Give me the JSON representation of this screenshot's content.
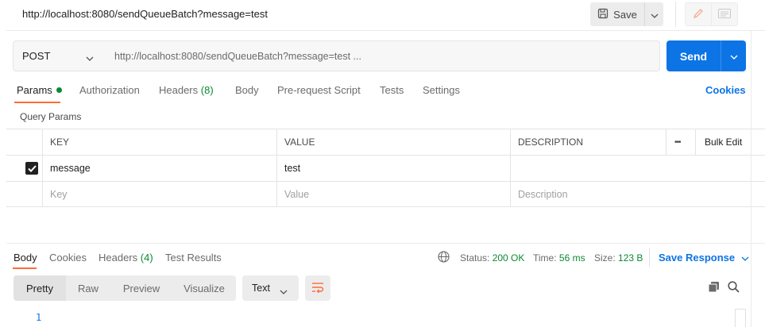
{
  "title": {
    "url": "http://localhost:8080/sendQueueBatch?message=test"
  },
  "toolbar": {
    "save_label": "Save"
  },
  "request": {
    "method": "POST",
    "url": "http://localhost:8080/sendQueueBatch?message=test ...",
    "send_label": "Send"
  },
  "tabs": {
    "params": "Params",
    "authorization": "Authorization",
    "headers": "Headers",
    "headers_count": "(8)",
    "body": "Body",
    "prerequest": "Pre-request Script",
    "tests": "Tests",
    "settings": "Settings",
    "cookies": "Cookies"
  },
  "query_params": {
    "section_label": "Query Params",
    "columns": {
      "key": "KEY",
      "value": "VALUE",
      "description": "DESCRIPTION",
      "more": "•••",
      "bulk_edit": "Bulk Edit"
    },
    "rows": [
      {
        "checked": true,
        "key": "message",
        "value": "test",
        "description": ""
      }
    ],
    "placeholders": {
      "key": "Key",
      "value": "Value",
      "description": "Description"
    }
  },
  "response": {
    "tabs": {
      "body": "Body",
      "cookies": "Cookies",
      "headers": "Headers",
      "headers_count": "(4)",
      "test_results": "Test Results"
    },
    "status_label": "Status:",
    "status_value": "200 OK",
    "time_label": "Time:",
    "time_value": "56 ms",
    "size_label": "Size:",
    "size_value": "123 B",
    "save_response": "Save Response",
    "view_modes": [
      "Pretty",
      "Raw",
      "Preview",
      "Visualize"
    ],
    "format": "Text",
    "line_numbers": [
      "1"
    ]
  },
  "colors": {
    "accent_blue": "#0c74e5",
    "tab_orange": "#ff6c37",
    "status_green": "#0a8a33"
  },
  "icons": [
    "save-icon",
    "chevron-down-icon",
    "pencil-icon",
    "document-icon",
    "globe-icon",
    "copy-icon",
    "search-icon",
    "wrap-lines-icon",
    "checkmark-icon"
  ]
}
